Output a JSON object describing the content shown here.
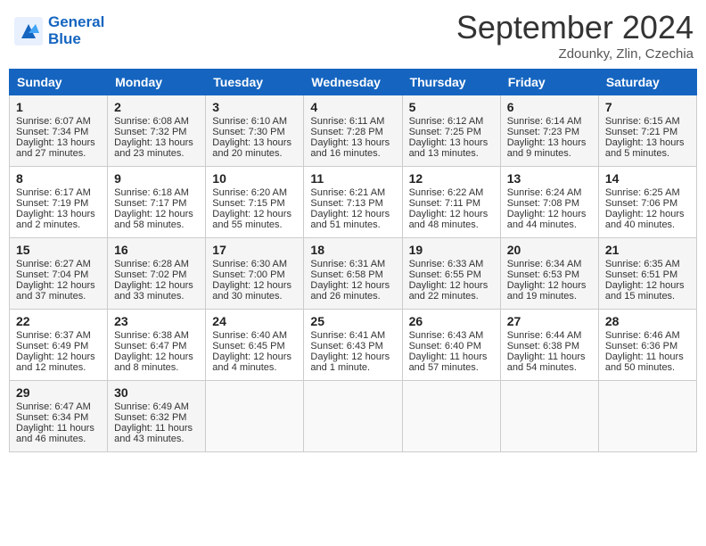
{
  "header": {
    "logo_line1": "General",
    "logo_line2": "Blue",
    "month_title": "September 2024",
    "location": "Zdounky, Zlin, Czechia"
  },
  "days_of_week": [
    "Sunday",
    "Monday",
    "Tuesday",
    "Wednesday",
    "Thursday",
    "Friday",
    "Saturday"
  ],
  "weeks": [
    [
      {
        "day": "1",
        "lines": [
          "Sunrise: 6:07 AM",
          "Sunset: 7:34 PM",
          "Daylight: 13 hours",
          "and 27 minutes."
        ]
      },
      {
        "day": "2",
        "lines": [
          "Sunrise: 6:08 AM",
          "Sunset: 7:32 PM",
          "Daylight: 13 hours",
          "and 23 minutes."
        ]
      },
      {
        "day": "3",
        "lines": [
          "Sunrise: 6:10 AM",
          "Sunset: 7:30 PM",
          "Daylight: 13 hours",
          "and 20 minutes."
        ]
      },
      {
        "day": "4",
        "lines": [
          "Sunrise: 6:11 AM",
          "Sunset: 7:28 PM",
          "Daylight: 13 hours",
          "and 16 minutes."
        ]
      },
      {
        "day": "5",
        "lines": [
          "Sunrise: 6:12 AM",
          "Sunset: 7:25 PM",
          "Daylight: 13 hours",
          "and 13 minutes."
        ]
      },
      {
        "day": "6",
        "lines": [
          "Sunrise: 6:14 AM",
          "Sunset: 7:23 PM",
          "Daylight: 13 hours",
          "and 9 minutes."
        ]
      },
      {
        "day": "7",
        "lines": [
          "Sunrise: 6:15 AM",
          "Sunset: 7:21 PM",
          "Daylight: 13 hours",
          "and 5 minutes."
        ]
      }
    ],
    [
      {
        "day": "8",
        "lines": [
          "Sunrise: 6:17 AM",
          "Sunset: 7:19 PM",
          "Daylight: 13 hours",
          "and 2 minutes."
        ]
      },
      {
        "day": "9",
        "lines": [
          "Sunrise: 6:18 AM",
          "Sunset: 7:17 PM",
          "Daylight: 12 hours",
          "and 58 minutes."
        ]
      },
      {
        "day": "10",
        "lines": [
          "Sunrise: 6:20 AM",
          "Sunset: 7:15 PM",
          "Daylight: 12 hours",
          "and 55 minutes."
        ]
      },
      {
        "day": "11",
        "lines": [
          "Sunrise: 6:21 AM",
          "Sunset: 7:13 PM",
          "Daylight: 12 hours",
          "and 51 minutes."
        ]
      },
      {
        "day": "12",
        "lines": [
          "Sunrise: 6:22 AM",
          "Sunset: 7:11 PM",
          "Daylight: 12 hours",
          "and 48 minutes."
        ]
      },
      {
        "day": "13",
        "lines": [
          "Sunrise: 6:24 AM",
          "Sunset: 7:08 PM",
          "Daylight: 12 hours",
          "and 44 minutes."
        ]
      },
      {
        "day": "14",
        "lines": [
          "Sunrise: 6:25 AM",
          "Sunset: 7:06 PM",
          "Daylight: 12 hours",
          "and 40 minutes."
        ]
      }
    ],
    [
      {
        "day": "15",
        "lines": [
          "Sunrise: 6:27 AM",
          "Sunset: 7:04 PM",
          "Daylight: 12 hours",
          "and 37 minutes."
        ]
      },
      {
        "day": "16",
        "lines": [
          "Sunrise: 6:28 AM",
          "Sunset: 7:02 PM",
          "Daylight: 12 hours",
          "and 33 minutes."
        ]
      },
      {
        "day": "17",
        "lines": [
          "Sunrise: 6:30 AM",
          "Sunset: 7:00 PM",
          "Daylight: 12 hours",
          "and 30 minutes."
        ]
      },
      {
        "day": "18",
        "lines": [
          "Sunrise: 6:31 AM",
          "Sunset: 6:58 PM",
          "Daylight: 12 hours",
          "and 26 minutes."
        ]
      },
      {
        "day": "19",
        "lines": [
          "Sunrise: 6:33 AM",
          "Sunset: 6:55 PM",
          "Daylight: 12 hours",
          "and 22 minutes."
        ]
      },
      {
        "day": "20",
        "lines": [
          "Sunrise: 6:34 AM",
          "Sunset: 6:53 PM",
          "Daylight: 12 hours",
          "and 19 minutes."
        ]
      },
      {
        "day": "21",
        "lines": [
          "Sunrise: 6:35 AM",
          "Sunset: 6:51 PM",
          "Daylight: 12 hours",
          "and 15 minutes."
        ]
      }
    ],
    [
      {
        "day": "22",
        "lines": [
          "Sunrise: 6:37 AM",
          "Sunset: 6:49 PM",
          "Daylight: 12 hours",
          "and 12 minutes."
        ]
      },
      {
        "day": "23",
        "lines": [
          "Sunrise: 6:38 AM",
          "Sunset: 6:47 PM",
          "Daylight: 12 hours",
          "and 8 minutes."
        ]
      },
      {
        "day": "24",
        "lines": [
          "Sunrise: 6:40 AM",
          "Sunset: 6:45 PM",
          "Daylight: 12 hours",
          "and 4 minutes."
        ]
      },
      {
        "day": "25",
        "lines": [
          "Sunrise: 6:41 AM",
          "Sunset: 6:43 PM",
          "Daylight: 12 hours",
          "and 1 minute."
        ]
      },
      {
        "day": "26",
        "lines": [
          "Sunrise: 6:43 AM",
          "Sunset: 6:40 PM",
          "Daylight: 11 hours",
          "and 57 minutes."
        ]
      },
      {
        "day": "27",
        "lines": [
          "Sunrise: 6:44 AM",
          "Sunset: 6:38 PM",
          "Daylight: 11 hours",
          "and 54 minutes."
        ]
      },
      {
        "day": "28",
        "lines": [
          "Sunrise: 6:46 AM",
          "Sunset: 6:36 PM",
          "Daylight: 11 hours",
          "and 50 minutes."
        ]
      }
    ],
    [
      {
        "day": "29",
        "lines": [
          "Sunrise: 6:47 AM",
          "Sunset: 6:34 PM",
          "Daylight: 11 hours",
          "and 46 minutes."
        ]
      },
      {
        "day": "30",
        "lines": [
          "Sunrise: 6:49 AM",
          "Sunset: 6:32 PM",
          "Daylight: 11 hours",
          "and 43 minutes."
        ]
      },
      {
        "day": "",
        "lines": []
      },
      {
        "day": "",
        "lines": []
      },
      {
        "day": "",
        "lines": []
      },
      {
        "day": "",
        "lines": []
      },
      {
        "day": "",
        "lines": []
      }
    ]
  ]
}
